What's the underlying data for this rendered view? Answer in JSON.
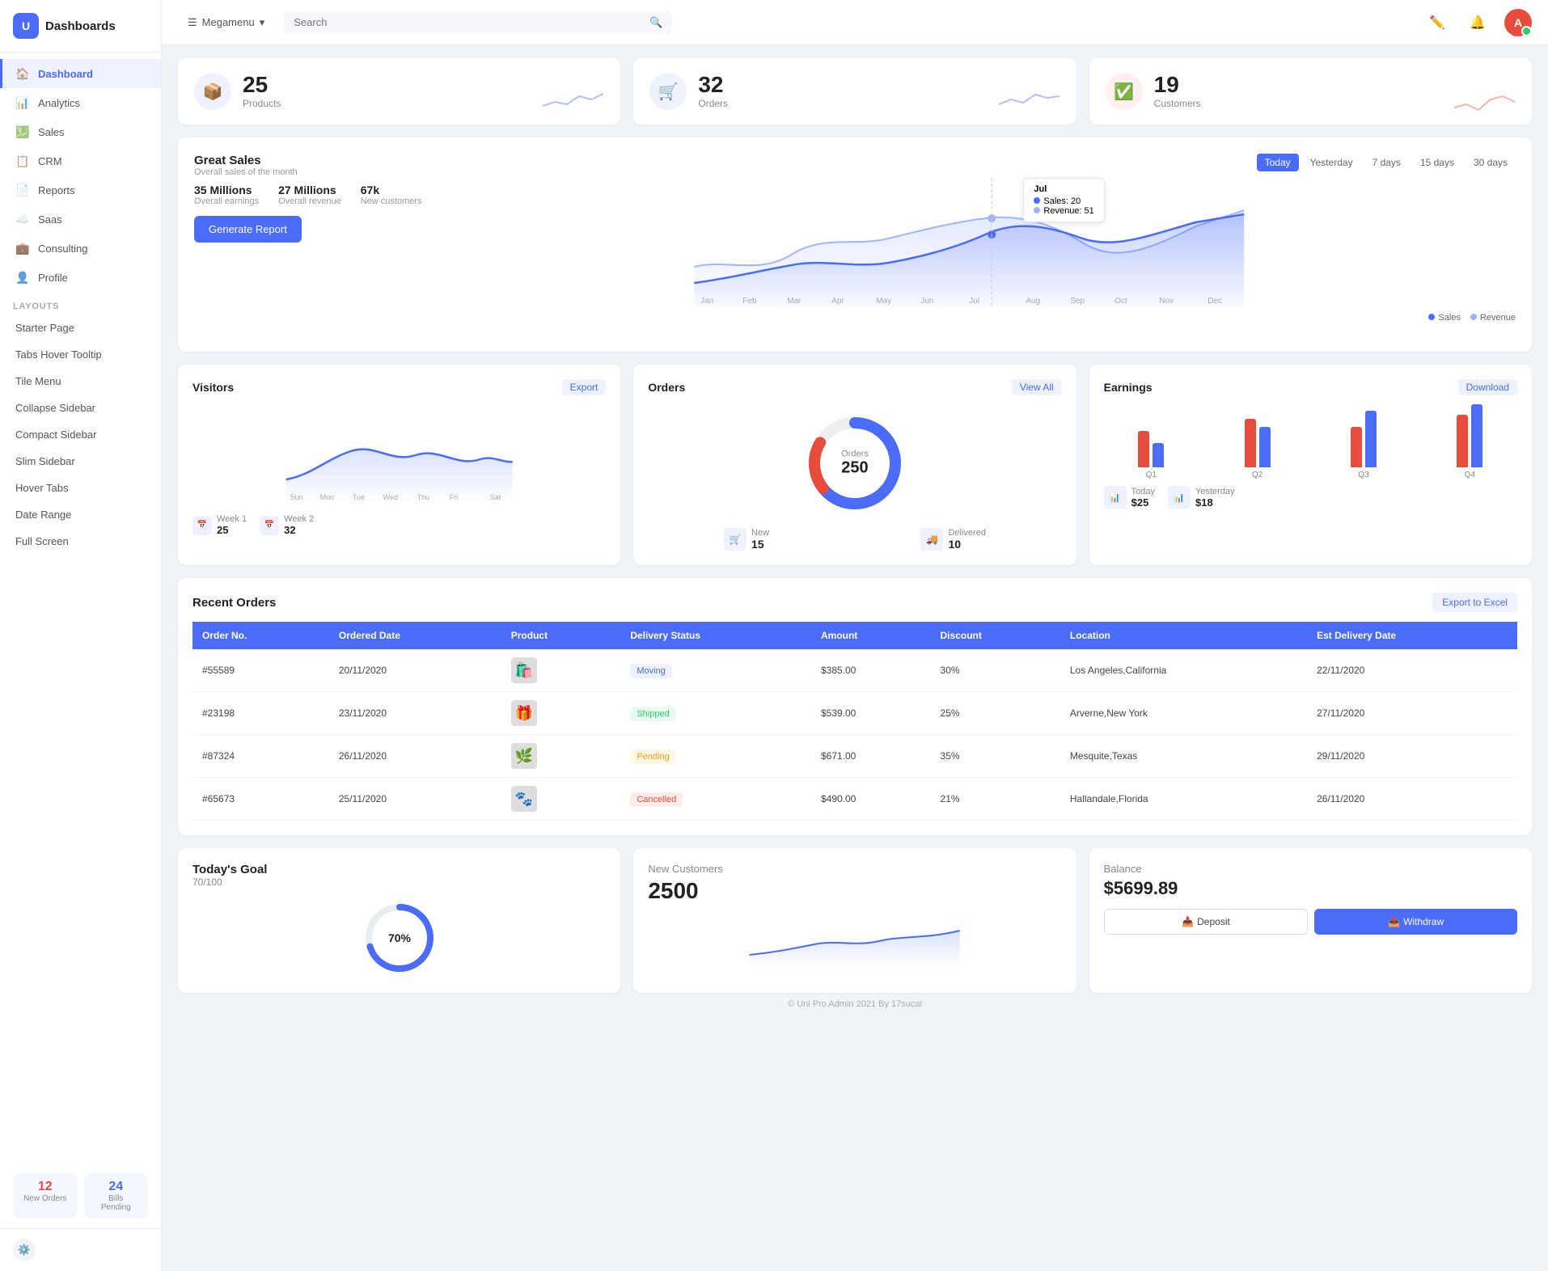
{
  "app": {
    "name": "Dashboards",
    "logo_text": "U"
  },
  "topbar": {
    "megamenu_label": "Megamenu",
    "search_placeholder": "Search",
    "avatar_text": "A"
  },
  "sidebar": {
    "active_item": "dashboard",
    "nav_items": [
      {
        "id": "dashboard",
        "label": "Dashboard",
        "icon": "🏠"
      },
      {
        "id": "analytics",
        "label": "Analytics",
        "icon": "📊"
      },
      {
        "id": "sales",
        "label": "Sales",
        "icon": "💹"
      },
      {
        "id": "crm",
        "label": "CRM",
        "icon": "📋"
      },
      {
        "id": "reports",
        "label": "Reports",
        "icon": "📄"
      },
      {
        "id": "saas",
        "label": "Saas",
        "icon": "☁️"
      },
      {
        "id": "consulting",
        "label": "Consulting",
        "icon": "💼"
      },
      {
        "id": "profile",
        "label": "Profile",
        "icon": "👤"
      }
    ],
    "layouts_label": "LAYOUTS",
    "layout_items": [
      {
        "id": "starter",
        "label": "Starter Page"
      },
      {
        "id": "tabs-hover",
        "label": "Tabs Hover Tooltip"
      },
      {
        "id": "tile-menu",
        "label": "Tile Menu"
      },
      {
        "id": "collapse-sidebar",
        "label": "Collapse Sidebar"
      },
      {
        "id": "compact-sidebar",
        "label": "Compact Sidebar"
      },
      {
        "id": "slim-sidebar",
        "label": "Slim Sidebar"
      },
      {
        "id": "hover-tabs",
        "label": "Hover Tabs"
      },
      {
        "id": "date-range",
        "label": "Date Range"
      },
      {
        "id": "full-screen",
        "label": "Full Screen"
      }
    ],
    "badge_new_orders": "12",
    "badge_new_orders_label": "New Orders",
    "badge_bills": "24",
    "badge_bills_label": "Bills Pending"
  },
  "stat_cards": [
    {
      "id": "products",
      "num": "25",
      "label": "Products",
      "icon": "📦",
      "color": "#4a6cf7"
    },
    {
      "id": "orders",
      "num": "32",
      "label": "Orders",
      "icon": "🛒",
      "color": "#4a6cf7"
    },
    {
      "id": "customers",
      "num": "19",
      "label": "Customers",
      "icon": "✅",
      "color": "#e74c3c"
    }
  ],
  "sales_chart": {
    "title": "Great Sales",
    "subtitle": "Overall sales of the month",
    "metrics": [
      {
        "val": "35 Millions",
        "lbl": "Overall earnings"
      },
      {
        "val": "27 Millions",
        "lbl": "Overall revenue"
      },
      {
        "val": "67k",
        "lbl": "New customers"
      }
    ],
    "time_filters": [
      "Today",
      "Yesterday",
      "7 days",
      "15 days",
      "30 days"
    ],
    "active_filter": "Today",
    "generate_btn": "Generate Report",
    "x_labels": [
      "Jan",
      "Feb",
      "Mar",
      "Apr",
      "May",
      "Jun",
      "Jul",
      "Aug",
      "Sep",
      "Oct",
      "Nov",
      "Dec"
    ],
    "legend_sales": "Sales",
    "legend_revenue": "Revenue",
    "tooltip": {
      "month": "Jul",
      "sales_label": "Sales:",
      "sales_val": "20",
      "revenue_label": "Revenue:",
      "revenue_val": "51"
    }
  },
  "visitors": {
    "title": "Visitors",
    "export_btn": "Export",
    "x_labels": [
      "Sun",
      "Mon",
      "Tue",
      "Wed",
      "Thu",
      "Fri",
      "Sat"
    ],
    "week1_label": "Week 1",
    "week1_val": "25",
    "week2_label": "Week 2",
    "week2_val": "32"
  },
  "orders_panel": {
    "title": "Orders",
    "view_all_btn": "View All",
    "donut_label": "Orders",
    "donut_num": "250",
    "new_label": "New",
    "new_val": "15",
    "delivered_label": "Delivered",
    "delivered_val": "10"
  },
  "earnings": {
    "title": "Earnings",
    "download_btn": "Download",
    "quarters": [
      "Q1",
      "Q2",
      "Q3",
      "Q4"
    ],
    "today_label": "Today",
    "today_val": "$25",
    "yesterday_label": "Yesterday",
    "yesterday_val": "$18"
  },
  "recent_orders": {
    "title": "Recent Orders",
    "export_btn": "Export to Excel",
    "columns": [
      "Order No.",
      "Ordered Date",
      "Product",
      "Delivery Status",
      "Amount",
      "Discount",
      "Location",
      "Est Delivery Date"
    ],
    "rows": [
      {
        "order_no": "#55589",
        "date": "20/11/2020",
        "product_icon": "🛍️",
        "status": "Moving",
        "status_class": "status-moving",
        "amount": "$385.00",
        "discount": "30%",
        "location": "Los Angeles,California",
        "delivery": "22/11/2020"
      },
      {
        "order_no": "#23198",
        "date": "23/11/2020",
        "product_icon": "🎁",
        "status": "Shipped",
        "status_class": "status-shipped",
        "amount": "$539.00",
        "discount": "25%",
        "location": "Arverne,New York",
        "delivery": "27/11/2020"
      },
      {
        "order_no": "#87324",
        "date": "26/11/2020",
        "product_icon": "🌿",
        "status": "Pending",
        "status_class": "status-pending",
        "amount": "$671.00",
        "discount": "35%",
        "location": "Mesquite,Texas",
        "delivery": "29/11/2020"
      },
      {
        "order_no": "#65673",
        "date": "25/11/2020",
        "product_icon": "🐾",
        "status": "Cancelled",
        "status_class": "status-cancelled",
        "amount": "$490.00",
        "discount": "21%",
        "location": "Hallandale,Florida",
        "delivery": "26/11/2020"
      }
    ]
  },
  "todays_goal": {
    "title": "Today's Goal",
    "subtitle": "70/100",
    "percent": 70
  },
  "new_customers": {
    "title": "New Customers",
    "num": "2500"
  },
  "balance": {
    "title": "Balance",
    "amount": "$5699.89",
    "deposit_btn": "Deposit",
    "withdraw_btn": "Withdraw"
  },
  "footer": {
    "text": "© Uni Pro Admin 2021 By 17sucai"
  }
}
